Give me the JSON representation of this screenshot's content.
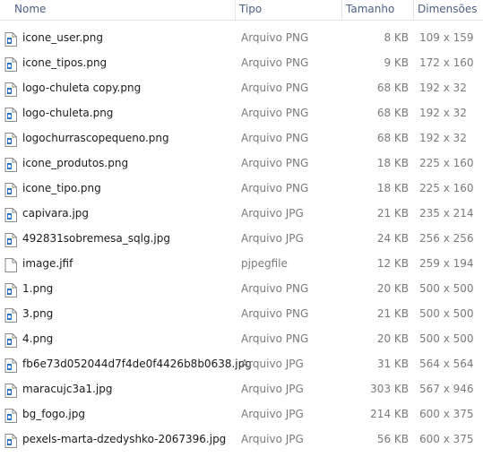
{
  "columns": {
    "name": "Nome",
    "type": "Tipo",
    "size": "Tamanho",
    "dims": "Dimensões"
  },
  "rows": [
    {
      "name": "icone_user.png",
      "type": "Arquivo PNG",
      "size": "8 KB",
      "dims": "109 x 159",
      "icon": "image-file-icon"
    },
    {
      "name": "icone_tipos.png",
      "type": "Arquivo PNG",
      "size": "9 KB",
      "dims": "172 x 160",
      "icon": "image-file-icon"
    },
    {
      "name": "logo-chuleta copy.png",
      "type": "Arquivo PNG",
      "size": "68 KB",
      "dims": "192 x 32",
      "icon": "image-file-icon"
    },
    {
      "name": "logo-chuleta.png",
      "type": "Arquivo PNG",
      "size": "68 KB",
      "dims": "192 x 32",
      "icon": "image-file-icon"
    },
    {
      "name": "logochurrascopequeno.png",
      "type": "Arquivo PNG",
      "size": "68 KB",
      "dims": "192 x 32",
      "icon": "image-file-icon"
    },
    {
      "name": "icone_produtos.png",
      "type": "Arquivo PNG",
      "size": "18 KB",
      "dims": "225 x 160",
      "icon": "image-file-icon"
    },
    {
      "name": "icone_tipo.png",
      "type": "Arquivo PNG",
      "size": "18 KB",
      "dims": "225 x 160",
      "icon": "image-file-icon"
    },
    {
      "name": "capivara.jpg",
      "type": "Arquivo JPG",
      "size": "21 KB",
      "dims": "235 x 214",
      "icon": "image-file-icon"
    },
    {
      "name": "492831sobremesa_sqlg.jpg",
      "type": "Arquivo JPG",
      "size": "24 KB",
      "dims": "256 x 256",
      "icon": "image-file-icon"
    },
    {
      "name": "image.jfif",
      "type": "pjpegfile",
      "size": "12 KB",
      "dims": "259 x 194",
      "icon": "blank-file-icon"
    },
    {
      "name": "1.png",
      "type": "Arquivo PNG",
      "size": "20 KB",
      "dims": "500 x 500",
      "icon": "image-file-icon"
    },
    {
      "name": "3.png",
      "type": "Arquivo PNG",
      "size": "21 KB",
      "dims": "500 x 500",
      "icon": "image-file-icon"
    },
    {
      "name": "4.png",
      "type": "Arquivo PNG",
      "size": "20 KB",
      "dims": "500 x 500",
      "icon": "image-file-icon"
    },
    {
      "name": "fb6e73d052044d7f4de0f4426b8b0638.jpg",
      "type": "Arquivo JPG",
      "size": "31 KB",
      "dims": "564 x 564",
      "icon": "image-file-icon"
    },
    {
      "name": "maracujc3a1.jpg",
      "type": "Arquivo JPG",
      "size": "303 KB",
      "dims": "567 x 946",
      "icon": "image-file-icon"
    },
    {
      "name": "bg_fogo.jpg",
      "type": "Arquivo JPG",
      "size": "214 KB",
      "dims": "600 x 375",
      "icon": "image-file-icon"
    },
    {
      "name": "pexels-marta-dzedyshko-2067396.jpg",
      "type": "Arquivo JPG",
      "size": "56 KB",
      "dims": "600 x 375",
      "icon": "image-file-icon"
    }
  ],
  "colors": {
    "header_text": "#4d6082",
    "secondary_text": "#7a7a7a",
    "icon_blue": "#2b72c9"
  }
}
